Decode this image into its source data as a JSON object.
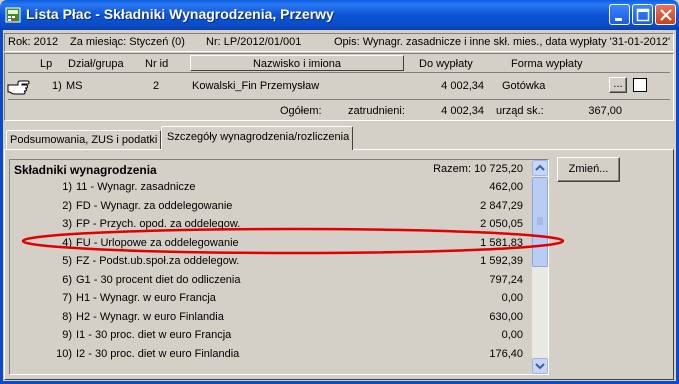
{
  "window": {
    "title": "Lista Płac - Składniki Wynagrodzenia, Przerwy"
  },
  "info": {
    "rok": "Rok: 2012",
    "miesiac": "Za miesiąc: Styczeń (0)",
    "nr": "Nr: LP/2012/01/001",
    "opis": "Opis:  Wynagr. zasadnicze i inne skł. mies., data wypłaty '31-01-2012'"
  },
  "employees": {
    "headers": {
      "lp": "Lp",
      "dzial": "Dział/grupa",
      "nrid": "Nr id",
      "nazwisko": "Nazwisko i imiona",
      "do_wyplaty": "Do wypłaty",
      "forma": "Forma wypłaty"
    },
    "row": {
      "lp": "1)",
      "dzial": "MS",
      "nrid": "2",
      "nazwisko": "Kowalski_Fin Przemysław",
      "do_wyplaty": "4 002,34",
      "forma": "Gotówka",
      "more_btn": "..."
    },
    "summary": {
      "ogolem_label": "Ogółem:",
      "zatrudnieni_label": "zatrudnieni:",
      "kwota": "4 002,34",
      "urzad_label": "urząd sk.:",
      "urzad_kwota": "367,00"
    }
  },
  "tabs": [
    {
      "label": "Podsumowania, ZUS i podatki"
    },
    {
      "label": "Szczegóły wynagrodzenia/rozliczenia"
    }
  ],
  "skladniki": {
    "header": "Składniki wynagrodzenia",
    "razem": "Razem: 10 725,20",
    "items": [
      {
        "num": "1)",
        "name": "11 - Wynagr. zasadnicze",
        "value": "462,00"
      },
      {
        "num": "2)",
        "name": "FD - Wynagr. za oddelegowanie",
        "value": "2 847,29"
      },
      {
        "num": "3)",
        "name": "FP - Przych. opod. za oddelegow.",
        "value": "2 050,05"
      },
      {
        "num": "4)",
        "name": "FU - Urlopowe za oddelegowanie",
        "value": "1 581,83"
      },
      {
        "num": "5)",
        "name": "FZ - Podst.ub.społ.za oddelegow.",
        "value": "1 592,39"
      },
      {
        "num": "6)",
        "name": "G1 - 30 procent diet do odliczenia",
        "value": "797,24"
      },
      {
        "num": "7)",
        "name": "H1 - Wynagr. w euro Francja",
        "value": "0,00"
      },
      {
        "num": "8)",
        "name": "H2 - Wynagr. w euro Finlandia",
        "value": "630,00"
      },
      {
        "num": "9)",
        "name": "I1 - 30 proc. diet w euro Francja",
        "value": "0,00"
      },
      {
        "num": "10)",
        "name": "I2 - 30 proc. diet w euro Finlandia",
        "value": "176,40"
      }
    ],
    "change_btn": "Zmień..."
  },
  "colors": {
    "titlebar": "#0a4cc8",
    "highlight_ellipse": "#e00000"
  },
  "icons": {
    "app": "calculator-icon",
    "pointer": "pointing-hand-icon"
  }
}
